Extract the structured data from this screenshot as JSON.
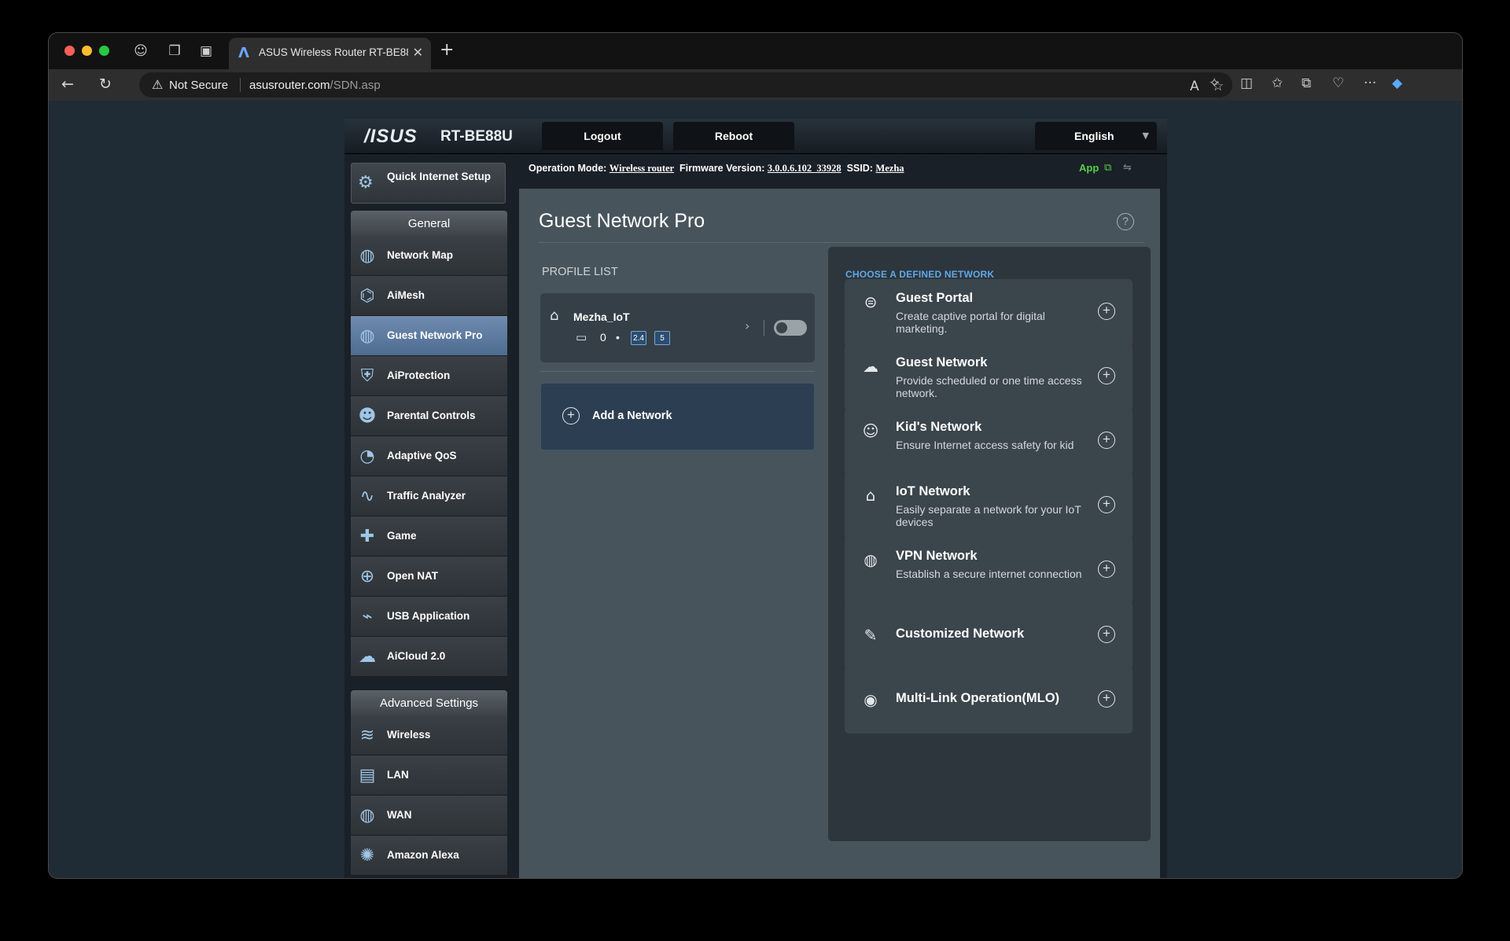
{
  "browser": {
    "tab_title": "ASUS Wireless Router RT-BE88U",
    "security_label": "Not Secure",
    "url_host": "asusrouter.com",
    "url_path": "/SDN.asp"
  },
  "router": {
    "brand": "/ISUS",
    "model": "RT-BE88U",
    "logout_label": "Logout",
    "reboot_label": "Reboot",
    "language": "English",
    "status": {
      "operation_mode_label": "Operation Mode:",
      "operation_mode": "Wireless router",
      "firmware_label": "Firmware Version:",
      "firmware": "3.0.0.6.102_33928",
      "ssid_label": "SSID:",
      "ssid": "Mezha",
      "app_label": "App"
    }
  },
  "sidebar": {
    "quick_setup_label": "Quick Internet Setup",
    "general_title": "General",
    "general_items": [
      {
        "label": "Network Map",
        "icon": "globe-icon"
      },
      {
        "label": "AiMesh",
        "icon": "mesh-icon"
      },
      {
        "label": "Guest Network Pro",
        "icon": "guest-globe-icon",
        "active": true
      },
      {
        "label": "AiProtection",
        "icon": "lock-shield-icon"
      },
      {
        "label": "Parental Controls",
        "icon": "family-icon"
      },
      {
        "label": "Adaptive QoS",
        "icon": "speedometer-icon"
      },
      {
        "label": "Traffic Analyzer",
        "icon": "analyzer-icon"
      },
      {
        "label": "Game",
        "icon": "gamepad-icon"
      },
      {
        "label": "Open NAT",
        "icon": "open-nat-icon"
      },
      {
        "label": "USB Application",
        "icon": "usb-icon"
      },
      {
        "label": "AiCloud 2.0",
        "icon": "cloud-icon"
      }
    ],
    "advanced_title": "Advanced Settings",
    "advanced_items": [
      {
        "label": "Wireless",
        "icon": "wifi-icon"
      },
      {
        "label": "LAN",
        "icon": "lan-icon"
      },
      {
        "label": "WAN",
        "icon": "wan-globe-icon"
      },
      {
        "label": "Amazon Alexa",
        "icon": "alexa-icon"
      }
    ]
  },
  "main": {
    "title": "Guest Network Pro",
    "profile_list_label": "PROFILE LIST",
    "profile": {
      "name": "Mezha_IoT",
      "device_count": "0",
      "band_24": "2.4",
      "band_5": "5",
      "enabled": false
    },
    "add_network_label": "Add a Network",
    "choose_title": "CHOOSE A DEFINED NETWORK",
    "networks": [
      {
        "title": "Guest Portal",
        "desc": "Create captive portal for digital marketing.",
        "icon": "portal-icon"
      },
      {
        "title": "Guest Network",
        "desc": "Provide scheduled or one time access network.",
        "icon": "guest-network-icon"
      },
      {
        "title": "Kid's Network",
        "desc": "Ensure Internet access safety for kid",
        "icon": "kid-icon"
      },
      {
        "title": "IoT Network",
        "desc": "Easily separate a network for your IoT devices",
        "icon": "iot-home-icon"
      },
      {
        "title": "VPN Network",
        "desc": "Establish a secure internet connection",
        "icon": "vpn-globe-icon"
      },
      {
        "title": "Customized Network",
        "desc": "",
        "icon": "wrench-icon"
      },
      {
        "title": "Multi-Link Operation(MLO)",
        "desc": "",
        "icon": "mlo-icon"
      }
    ]
  }
}
